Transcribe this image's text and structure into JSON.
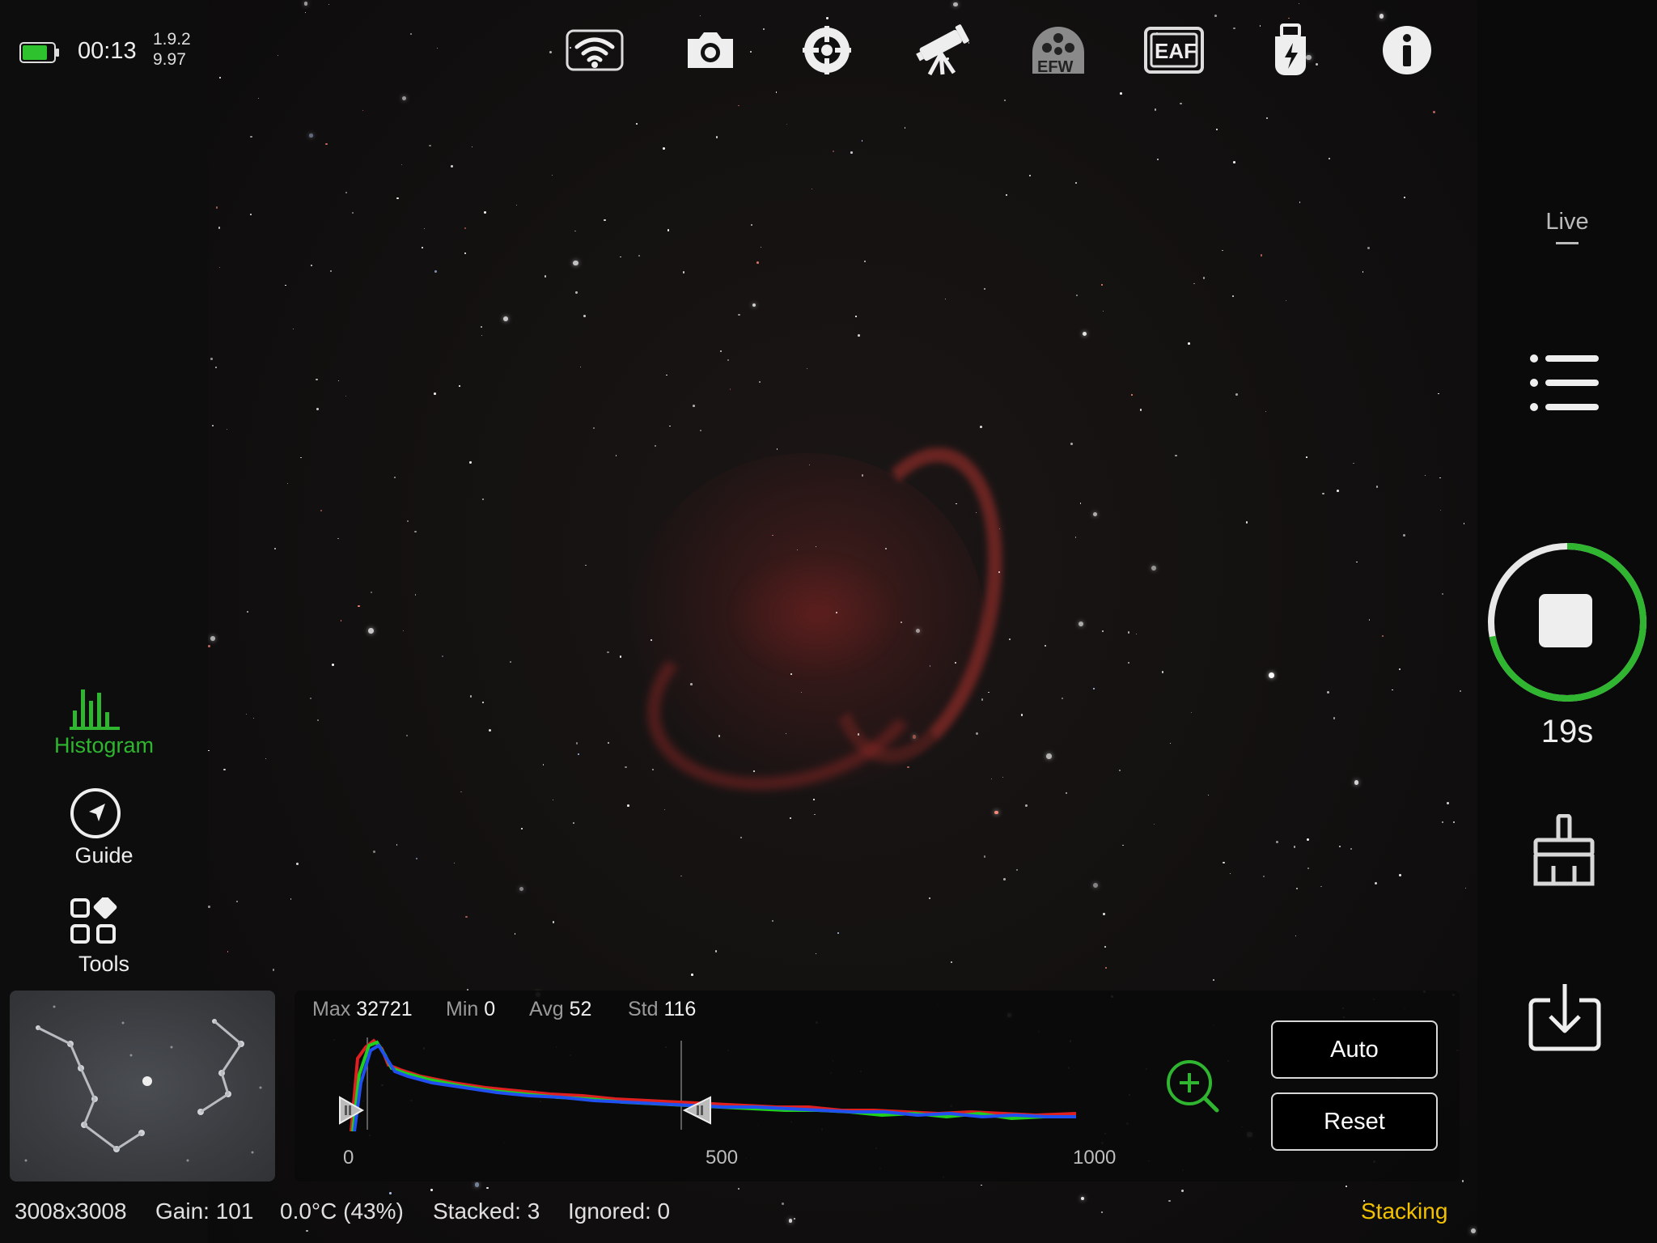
{
  "status": {
    "time": "00:13",
    "version_top": "1.9.2",
    "version_bottom": "9.97",
    "battery_color": "#2fc22f"
  },
  "top_toolbar": {
    "icons": [
      "wifi-icon",
      "camera-icon",
      "focus-target-icon",
      "telescope-icon",
      "efw-filter-wheel-icon",
      "eaf-focuser-icon",
      "usb-power-icon",
      "info-icon"
    ],
    "efw_label": "EFW",
    "eaf_label": "EAF"
  },
  "left_nav": {
    "items": [
      {
        "label": "Histogram",
        "icon": "histogram-icon",
        "active": true
      },
      {
        "label": "Guide",
        "icon": "guide-compass-icon",
        "active": false
      },
      {
        "label": "Tools",
        "icon": "tools-grid-icon",
        "active": false
      }
    ],
    "active_color": "#2fb52f"
  },
  "right_panel": {
    "mode_label": "Live",
    "timer": "19s",
    "progress_fraction": 0.72,
    "progress_color": "#2fb52f",
    "icons": [
      "menu-list-icon",
      "stop-icon",
      "broom-clean-icon",
      "download-icon"
    ]
  },
  "histogram": {
    "max_label": "Max",
    "max_value": "32721",
    "min_label": "Min",
    "min_value": "0",
    "avg_label": "Avg",
    "avg_value": "52",
    "std_label": "Std",
    "std_value": "116",
    "ticks": [
      "0",
      "500",
      "1000"
    ],
    "auto_button": "Auto",
    "reset_button": "Reset",
    "zoom_icon": "zoom-in-icon"
  },
  "bottom_status": {
    "resolution": "3008x3008",
    "gain": "Gain: 101",
    "temperature": "0.0°C (43%)",
    "stacked": "Stacked: 3",
    "ignored": "Ignored: 0",
    "state": "Stacking",
    "state_color": "#f2c200"
  }
}
